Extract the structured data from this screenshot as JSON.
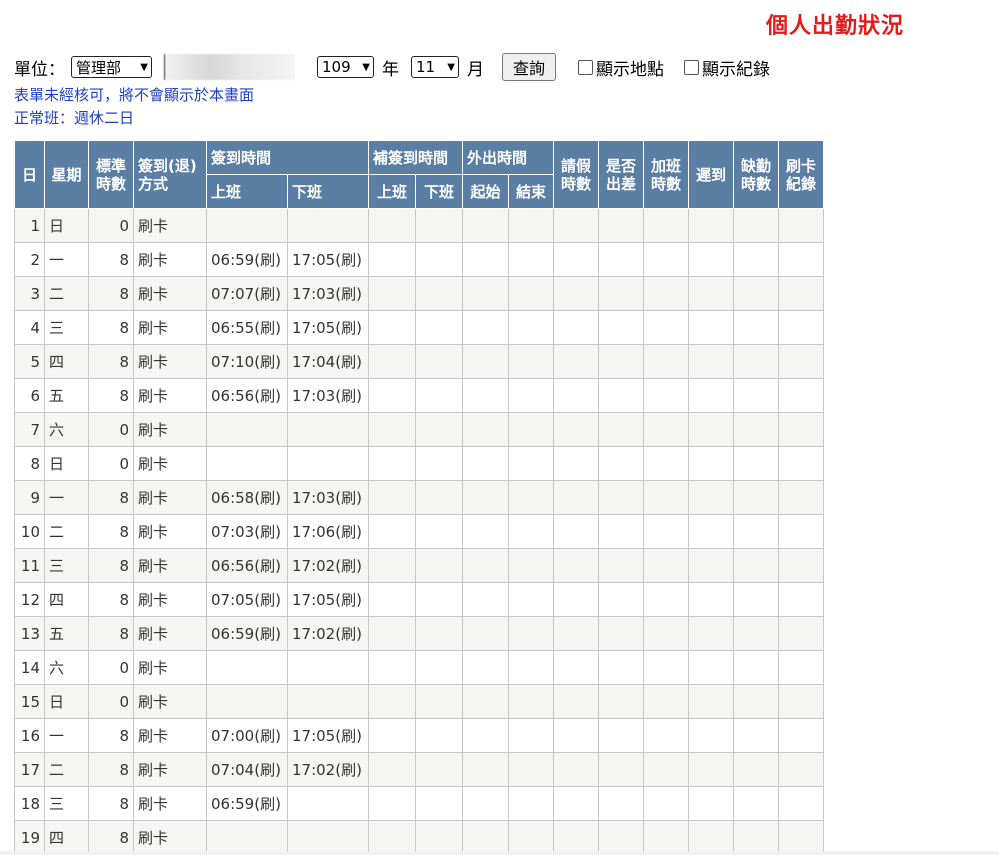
{
  "title": "個人出勤狀況",
  "filters": {
    "unit_label": "單位：",
    "unit_value": "管理部",
    "year_value": "109",
    "year_label": "年",
    "month_value": "11",
    "month_label": "月",
    "query_button": "查詢",
    "show_location_label": "顯示地點",
    "show_record_label": "顯示紀錄"
  },
  "notes": {
    "unverified": "表單未經核可，將不會顯示於本畫面",
    "shift": "正常班：週休二日"
  },
  "table": {
    "headers": {
      "day": "日",
      "weekday": "星期",
      "standard_hours": [
        "標準",
        "時數"
      ],
      "sign_method": [
        "簽到(退)",
        "方式"
      ],
      "sign_time": "簽到時間",
      "sign_on": "上班",
      "sign_off": "下班",
      "supp_sign_time": "補簽到時間",
      "supp_on": "上班",
      "supp_off": "下班",
      "outing_time": "外出時間",
      "outing_start": "起始",
      "outing_end": "結束",
      "leave_hours": [
        "請假",
        "時數"
      ],
      "business_trip": [
        "是否",
        "出差"
      ],
      "overtime_hours": [
        "加班",
        "時數"
      ],
      "late": "遲到",
      "absent_hours": [
        "缺勤",
        "時數"
      ],
      "card_record": [
        "刷卡",
        "紀錄"
      ]
    },
    "rows": [
      {
        "day": "1",
        "weekday": "日",
        "hours": "0",
        "method": "刷卡",
        "on": "",
        "off": ""
      },
      {
        "day": "2",
        "weekday": "一",
        "hours": "8",
        "method": "刷卡",
        "on": "06:59(刷)",
        "off": "17:05(刷)"
      },
      {
        "day": "3",
        "weekday": "二",
        "hours": "8",
        "method": "刷卡",
        "on": "07:07(刷)",
        "off": "17:03(刷)"
      },
      {
        "day": "4",
        "weekday": "三",
        "hours": "8",
        "method": "刷卡",
        "on": "06:55(刷)",
        "off": "17:05(刷)"
      },
      {
        "day": "5",
        "weekday": "四",
        "hours": "8",
        "method": "刷卡",
        "on": "07:10(刷)",
        "off": "17:04(刷)"
      },
      {
        "day": "6",
        "weekday": "五",
        "hours": "8",
        "method": "刷卡",
        "on": "06:56(刷)",
        "off": "17:03(刷)"
      },
      {
        "day": "7",
        "weekday": "六",
        "hours": "0",
        "method": "刷卡",
        "on": "",
        "off": ""
      },
      {
        "day": "8",
        "weekday": "日",
        "hours": "0",
        "method": "刷卡",
        "on": "",
        "off": ""
      },
      {
        "day": "9",
        "weekday": "一",
        "hours": "8",
        "method": "刷卡",
        "on": "06:58(刷)",
        "off": "17:03(刷)"
      },
      {
        "day": "10",
        "weekday": "二",
        "hours": "8",
        "method": "刷卡",
        "on": "07:03(刷)",
        "off": "17:06(刷)"
      },
      {
        "day": "11",
        "weekday": "三",
        "hours": "8",
        "method": "刷卡",
        "on": "06:56(刷)",
        "off": "17:02(刷)"
      },
      {
        "day": "12",
        "weekday": "四",
        "hours": "8",
        "method": "刷卡",
        "on": "07:05(刷)",
        "off": "17:05(刷)"
      },
      {
        "day": "13",
        "weekday": "五",
        "hours": "8",
        "method": "刷卡",
        "on": "06:59(刷)",
        "off": "17:02(刷)"
      },
      {
        "day": "14",
        "weekday": "六",
        "hours": "0",
        "method": "刷卡",
        "on": "",
        "off": ""
      },
      {
        "day": "15",
        "weekday": "日",
        "hours": "0",
        "method": "刷卡",
        "on": "",
        "off": ""
      },
      {
        "day": "16",
        "weekday": "一",
        "hours": "8",
        "method": "刷卡",
        "on": "07:00(刷)",
        "off": "17:05(刷)"
      },
      {
        "day": "17",
        "weekday": "二",
        "hours": "8",
        "method": "刷卡",
        "on": "07:04(刷)",
        "off": "17:02(刷)"
      },
      {
        "day": "18",
        "weekday": "三",
        "hours": "8",
        "method": "刷卡",
        "on": "06:59(刷)",
        "off": ""
      },
      {
        "day": "19",
        "weekday": "四",
        "hours": "8",
        "method": "刷卡",
        "on": "",
        "off": ""
      }
    ]
  },
  "colors": {
    "title": "#e51b1b",
    "header_bg": "#5b7fa4",
    "note_text": "#1d3ec9"
  }
}
